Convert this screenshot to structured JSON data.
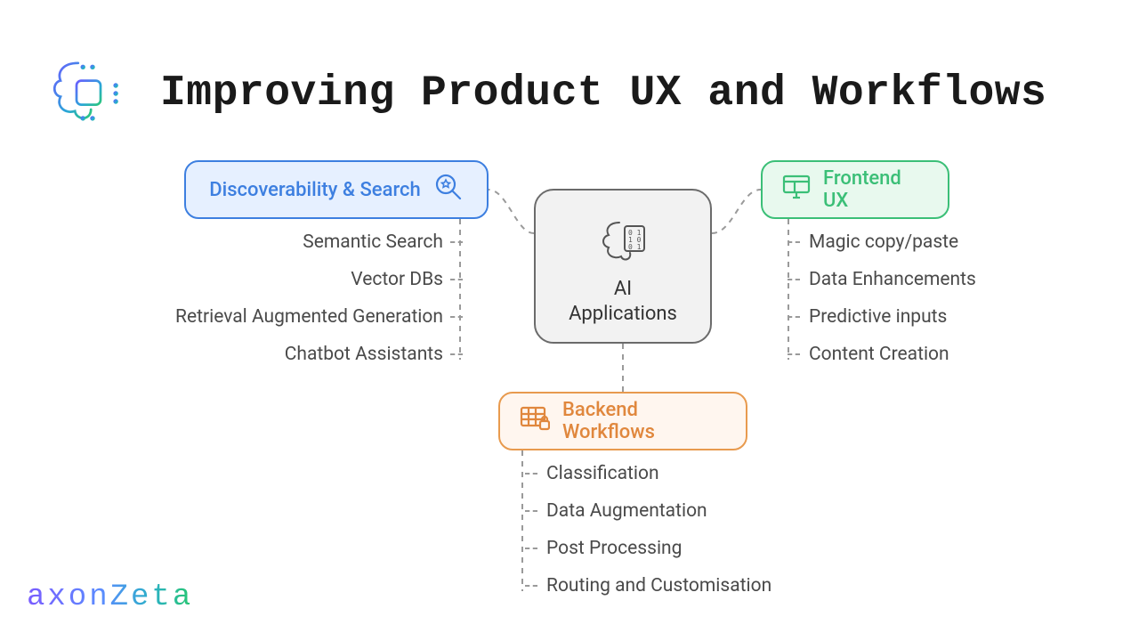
{
  "title": "Improving Product UX and Workflows",
  "brand": "axonZeta",
  "center": {
    "label_line1": "AI",
    "label_line2": "Applications"
  },
  "nodes": {
    "discoverability": {
      "label": "Discoverability & Search",
      "items": [
        "Semantic Search",
        "Vector DBs",
        "Retrieval Augmented Generation",
        "Chatbot Assistants"
      ]
    },
    "frontend": {
      "label": "Frontend UX",
      "items": [
        "Magic copy/paste",
        "Data Enhancements",
        "Predictive inputs",
        "Content Creation"
      ]
    },
    "backend": {
      "label": "Backend Workflows",
      "items": [
        "Classification",
        "Data Augmentation",
        "Post Processing",
        "Routing and Customisation"
      ]
    }
  },
  "colors": {
    "blue": "#3d7fe0",
    "green": "#3bbf77",
    "orange": "#e0873d",
    "gray": "#6b6b6b"
  }
}
